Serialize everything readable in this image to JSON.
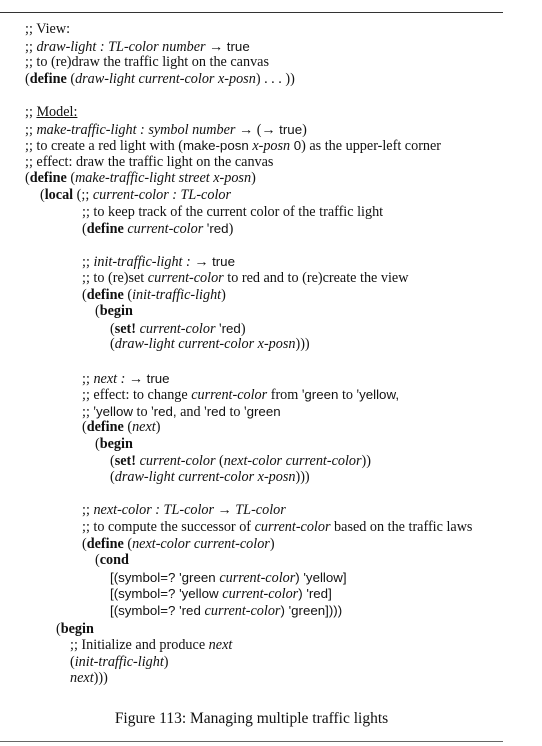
{
  "figure": {
    "caption": "Figure 113: Managing multiple traffic lights"
  },
  "lines": [
    {
      "indent": 0,
      "row": 0,
      "parts": [
        {
          "t": ";; ",
          "c": ""
        },
        {
          "t": "View:",
          "c": ""
        }
      ]
    },
    {
      "indent": 0,
      "row": 1,
      "parts": [
        {
          "t": ";; ",
          "c": ""
        },
        {
          "t": "draw-light : TL-color number → ",
          "c": "i"
        },
        {
          "t": "true",
          "c": "s"
        }
      ]
    },
    {
      "indent": 0,
      "row": 2,
      "parts": [
        {
          "t": ";; to (re)draw the traffic light on the canvas",
          "c": ""
        }
      ]
    },
    {
      "indent": 0,
      "row": 3,
      "parts": [
        {
          "t": "(",
          "c": ""
        },
        {
          "t": "define",
          "c": "b"
        },
        {
          "t": " (",
          "c": ""
        },
        {
          "t": "draw-light current-color x-posn",
          "c": "i"
        },
        {
          "t": ") . . . ))",
          "c": ""
        }
      ]
    },
    {
      "indent": 0,
      "row": 5,
      "parts": [
        {
          "t": ";; ",
          "c": ""
        },
        {
          "t": "Model:",
          "c": "u"
        }
      ]
    },
    {
      "indent": 0,
      "row": 6,
      "parts": [
        {
          "t": ";; ",
          "c": ""
        },
        {
          "t": "make-traffic-light : symbol number → ",
          "c": "i"
        },
        {
          "t": "(→ ",
          "c": ""
        },
        {
          "t": "true",
          "c": "s"
        },
        {
          "t": ")",
          "c": ""
        }
      ]
    },
    {
      "indent": 0,
      "row": 7,
      "parts": [
        {
          "t": ";; to create a red light with (",
          "c": ""
        },
        {
          "t": "make-posn",
          "c": "s"
        },
        {
          "t": " ",
          "c": ""
        },
        {
          "t": "x-posn",
          "c": "i"
        },
        {
          "t": " ",
          "c": ""
        },
        {
          "t": "0",
          "c": "s"
        },
        {
          "t": ") as the upper-left corner",
          "c": ""
        }
      ]
    },
    {
      "indent": 0,
      "row": 8,
      "parts": [
        {
          "t": ";; effect: draw the traffic light on the canvas",
          "c": ""
        }
      ]
    },
    {
      "indent": 0,
      "row": 9,
      "parts": [
        {
          "t": "(",
          "c": ""
        },
        {
          "t": "define",
          "c": "b"
        },
        {
          "t": " (",
          "c": ""
        },
        {
          "t": "make-traffic-light street x-posn",
          "c": "i"
        },
        {
          "t": ")",
          "c": ""
        }
      ]
    },
    {
      "indent": 1,
      "row": 10,
      "parts": [
        {
          "t": "(",
          "c": ""
        },
        {
          "t": "local",
          "c": "b"
        },
        {
          "t": " (;; ",
          "c": ""
        },
        {
          "t": "current-color : TL-color",
          "c": "i"
        }
      ]
    },
    {
      "indent": 2,
      "row": 11,
      "parts": [
        {
          "t": ";; to keep track of the current color of the traffic light",
          "c": ""
        }
      ]
    },
    {
      "indent": 2,
      "row": 12,
      "parts": [
        {
          "t": "(",
          "c": ""
        },
        {
          "t": "define",
          "c": "b"
        },
        {
          "t": " ",
          "c": ""
        },
        {
          "t": "current-color",
          "c": "i"
        },
        {
          "t": " '",
          "c": ""
        },
        {
          "t": "red",
          "c": "s"
        },
        {
          "t": ")",
          "c": ""
        }
      ]
    },
    {
      "indent": 2,
      "row": 14,
      "parts": [
        {
          "t": ";; ",
          "c": ""
        },
        {
          "t": "init-traffic-light : → ",
          "c": "i"
        },
        {
          "t": "true",
          "c": "s"
        }
      ]
    },
    {
      "indent": 2,
      "row": 15,
      "parts": [
        {
          "t": ";; to (re)set ",
          "c": ""
        },
        {
          "t": "current-color",
          "c": "i"
        },
        {
          "t": " to red and to (re)create the view",
          "c": ""
        }
      ]
    },
    {
      "indent": 2,
      "row": 16,
      "parts": [
        {
          "t": "(",
          "c": ""
        },
        {
          "t": "define",
          "c": "b"
        },
        {
          "t": " (",
          "c": ""
        },
        {
          "t": "init-traffic-light",
          "c": "i"
        },
        {
          "t": ")",
          "c": ""
        }
      ]
    },
    {
      "indent": 3,
      "row": 17,
      "parts": [
        {
          "t": "(",
          "c": ""
        },
        {
          "t": "begin",
          "c": "b"
        }
      ]
    },
    {
      "indent": 4,
      "row": 18,
      "parts": [
        {
          "t": "(",
          "c": ""
        },
        {
          "t": "set!",
          "c": "b"
        },
        {
          "t": " ",
          "c": ""
        },
        {
          "t": "current-color",
          "c": "i"
        },
        {
          "t": " '",
          "c": ""
        },
        {
          "t": "red",
          "c": "s"
        },
        {
          "t": ")",
          "c": ""
        }
      ]
    },
    {
      "indent": 4,
      "row": 19,
      "parts": [
        {
          "t": "(",
          "c": ""
        },
        {
          "t": "draw-light current-color x-posn",
          "c": "i"
        },
        {
          "t": ")))",
          "c": ""
        }
      ]
    },
    {
      "indent": 2,
      "row": 21,
      "parts": [
        {
          "t": ";; ",
          "c": ""
        },
        {
          "t": "next : → ",
          "c": "i"
        },
        {
          "t": "true",
          "c": "s"
        }
      ]
    },
    {
      "indent": 2,
      "row": 22,
      "parts": [
        {
          "t": ";; effect: to change ",
          "c": ""
        },
        {
          "t": "current-color",
          "c": "i"
        },
        {
          "t": " from '",
          "c": ""
        },
        {
          "t": "green",
          "c": "s"
        },
        {
          "t": " to '",
          "c": ""
        },
        {
          "t": "yellow,",
          "c": "s"
        }
      ]
    },
    {
      "indent": 2,
      "row": 23,
      "parts": [
        {
          "t": ";; '",
          "c": ""
        },
        {
          "t": "yellow",
          "c": "s"
        },
        {
          "t": " to '",
          "c": ""
        },
        {
          "t": "red,",
          "c": "s"
        },
        {
          "t": " and '",
          "c": ""
        },
        {
          "t": "red",
          "c": "s"
        },
        {
          "t": " to '",
          "c": ""
        },
        {
          "t": "green",
          "c": "s"
        }
      ]
    },
    {
      "indent": 2,
      "row": 24,
      "parts": [
        {
          "t": "(",
          "c": ""
        },
        {
          "t": "define",
          "c": "b"
        },
        {
          "t": " (",
          "c": ""
        },
        {
          "t": "next",
          "c": "i"
        },
        {
          "t": ")",
          "c": ""
        }
      ]
    },
    {
      "indent": 3,
      "row": 25,
      "parts": [
        {
          "t": "(",
          "c": ""
        },
        {
          "t": "begin",
          "c": "b"
        }
      ]
    },
    {
      "indent": 4,
      "row": 26,
      "parts": [
        {
          "t": "(",
          "c": ""
        },
        {
          "t": "set!",
          "c": "b"
        },
        {
          "t": " ",
          "c": ""
        },
        {
          "t": "current-color",
          "c": "i"
        },
        {
          "t": " (",
          "c": ""
        },
        {
          "t": "next-color current-color",
          "c": "i"
        },
        {
          "t": "))",
          "c": ""
        }
      ]
    },
    {
      "indent": 4,
      "row": 27,
      "parts": [
        {
          "t": "(",
          "c": ""
        },
        {
          "t": "draw-light current-color x-posn",
          "c": "i"
        },
        {
          "t": ")))",
          "c": ""
        }
      ]
    },
    {
      "indent": 2,
      "row": 29,
      "parts": [
        {
          "t": ";; ",
          "c": ""
        },
        {
          "t": "next-color : TL-color → TL-color",
          "c": "i"
        }
      ]
    },
    {
      "indent": 2,
      "row": 30,
      "parts": [
        {
          "t": ";; to compute the successor of ",
          "c": ""
        },
        {
          "t": "current-color",
          "c": "i"
        },
        {
          "t": " based on the traffic laws",
          "c": ""
        }
      ]
    },
    {
      "indent": 2,
      "row": 31,
      "parts": [
        {
          "t": "(",
          "c": ""
        },
        {
          "t": "define",
          "c": "b"
        },
        {
          "t": " (",
          "c": ""
        },
        {
          "t": "next-color current-color",
          "c": "i"
        },
        {
          "t": ")",
          "c": ""
        }
      ]
    },
    {
      "indent": 3,
      "row": 32,
      "parts": [
        {
          "t": "(",
          "c": ""
        },
        {
          "t": "cond",
          "c": "b"
        }
      ]
    },
    {
      "indent": 4,
      "row": 33,
      "parts": [
        {
          "t": "[(symbol=? 'green ",
          "c": "s"
        },
        {
          "t": "current-color",
          "c": "i"
        },
        {
          "t": ") 'yellow]",
          "c": "s"
        }
      ]
    },
    {
      "indent": 4,
      "row": 34,
      "parts": [
        {
          "t": "[(symbol=? 'yellow ",
          "c": "s"
        },
        {
          "t": "current-color",
          "c": "i"
        },
        {
          "t": ") 'red]",
          "c": "s"
        }
      ]
    },
    {
      "indent": 4,
      "row": 35,
      "parts": [
        {
          "t": "[(symbol=? 'red ",
          "c": "s"
        },
        {
          "t": "current-color",
          "c": "i"
        },
        {
          "t": ") 'green])))",
          "c": "s"
        }
      ]
    },
    {
      "indent": 5,
      "row": 36,
      "parts": [
        {
          "t": "(",
          "c": ""
        },
        {
          "t": "begin",
          "c": "b"
        }
      ]
    },
    {
      "indent": 6,
      "row": 37,
      "parts": [
        {
          "t": ";; Initialize and produce ",
          "c": ""
        },
        {
          "t": "next",
          "c": "i"
        }
      ]
    },
    {
      "indent": 6,
      "row": 38,
      "parts": [
        {
          "t": "(",
          "c": ""
        },
        {
          "t": "init-traffic-light",
          "c": "i"
        },
        {
          "t": ")",
          "c": ""
        }
      ]
    },
    {
      "indent": 6,
      "row": 39,
      "parts": [
        {
          "t": "next",
          "c": "i"
        },
        {
          "t": ")))",
          "c": ""
        }
      ]
    }
  ]
}
